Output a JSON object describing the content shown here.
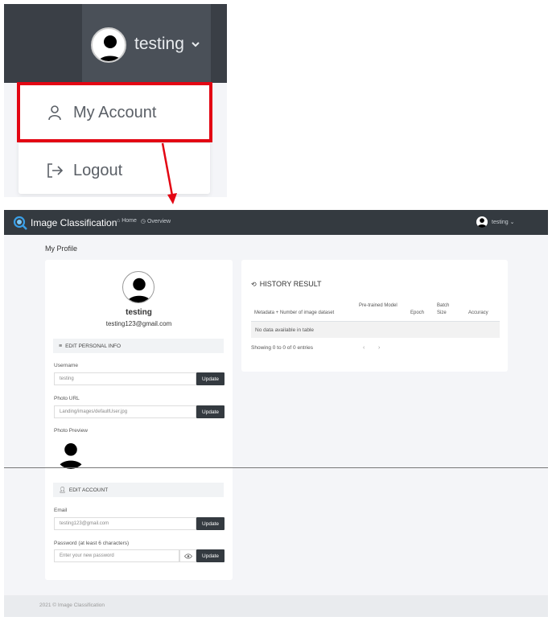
{
  "zoom": {
    "username": "testing",
    "menu": {
      "my_account": "My Account",
      "logout": "Logout"
    },
    "highlight_color": "#e30613"
  },
  "nav": {
    "brand": "Image Classification",
    "links": [
      {
        "label": "Home",
        "icon": "home-icon"
      },
      {
        "label": "Overview",
        "icon": "clock-icon"
      }
    ],
    "username": "testing"
  },
  "profile": {
    "page_title": "My Profile",
    "name": "testing",
    "email": "testing123@gmail.com",
    "edit_personal": {
      "heading": "EDIT PERSONAL INFO",
      "username_label": "Username",
      "username_value": "testing",
      "photo_url_label": "Photo URL",
      "photo_url_value": "Landing/images/defaultUser.jpg",
      "photo_preview_label": "Photo Preview",
      "update": "Update"
    },
    "edit_account": {
      "heading": "EDIT ACCOUNT",
      "email_label": "Email",
      "email_value": "testing123@gmail.com",
      "password_label": "Password (at least 6 characters)",
      "password_placeholder": "Enter your new password",
      "update": "Update"
    }
  },
  "history": {
    "title": "HISTORY RESULT",
    "columns": [
      "Metadata + Number of image dataset",
      "Pre-trained Model",
      "Epoch",
      "Batch Size",
      "Accuracy"
    ],
    "empty_text": "No data available in table",
    "info_text": "Showing 0 to 0 of 0 entries",
    "pager_prev": "‹",
    "pager_next": "›"
  },
  "footer": {
    "text": "2021 © Image Classification"
  },
  "colors": {
    "navbar": "#343a40",
    "button": "#343a40",
    "background": "#f4f5f8"
  }
}
